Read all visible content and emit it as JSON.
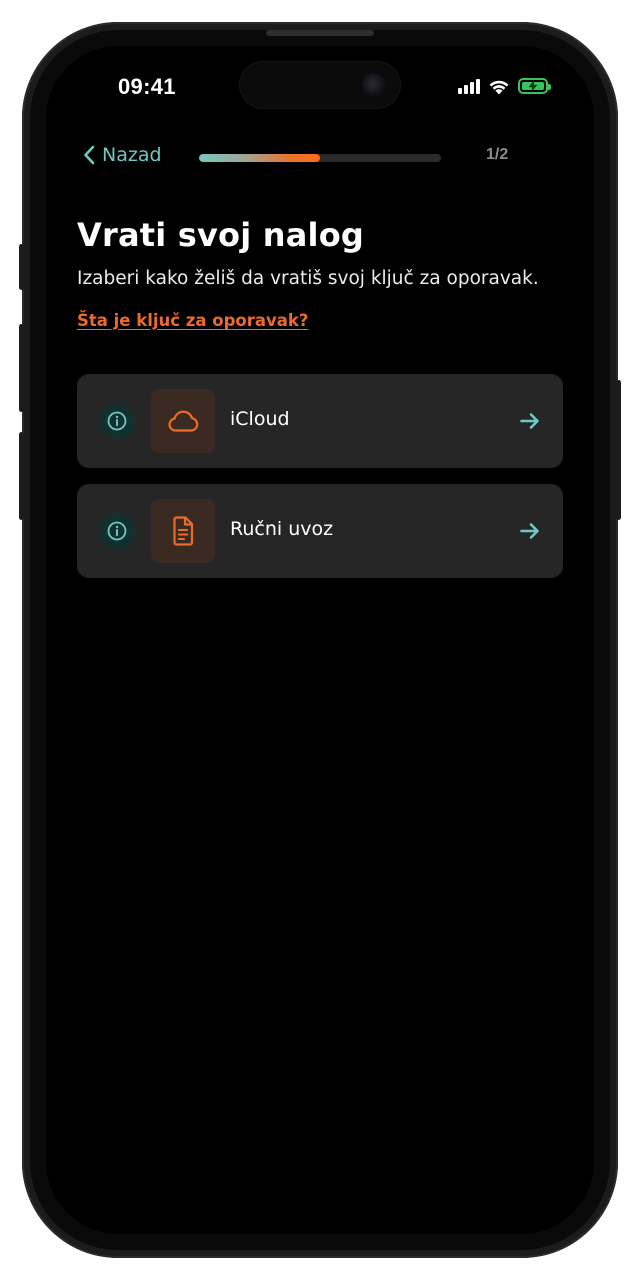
{
  "status_bar": {
    "time": "09:41",
    "signal_icon": "signal-bars-icon",
    "wifi_icon": "wifi-icon",
    "battery_icon": "battery-charging-icon",
    "battery_color": "#37c45a"
  },
  "nav": {
    "back_label": "Nazad",
    "back_icon": "chevron-left-icon",
    "progress_fraction": 0.5,
    "step_indicator": "1/2"
  },
  "header": {
    "title": "Vrati svoj nalog",
    "subtitle": "Izaberi kako želiš da vratiš svoj ključ za oporavak.",
    "help_link": "Šta je ključ za oporavak?"
  },
  "options": [
    {
      "label": "iCloud",
      "icon": "cloud-icon",
      "info_icon": "info-icon",
      "arrow_icon": "arrow-right-icon"
    },
    {
      "label": "Ručni uvoz",
      "icon": "document-icon",
      "info_icon": "info-icon",
      "arrow_icon": "arrow-right-icon"
    }
  ],
  "colors": {
    "accent_teal": "#6fc8c3",
    "accent_orange": "#ec6a2a",
    "card_background": "#262626",
    "screen_background": "#000000"
  }
}
